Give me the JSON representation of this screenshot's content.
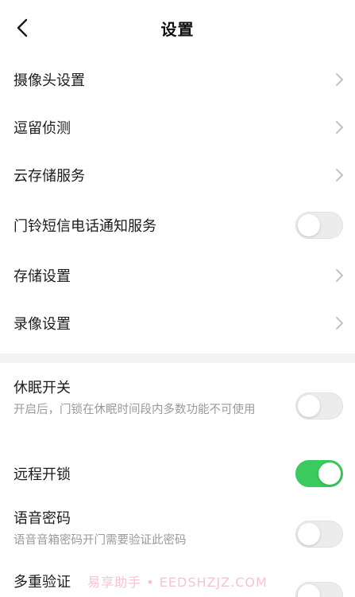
{
  "header": {
    "title": "设置"
  },
  "section1": {
    "items": [
      {
        "label": "摄像头设置"
      },
      {
        "label": "逗留侦测"
      },
      {
        "label": "云存储服务"
      },
      {
        "label": "门铃短信电话通知服务"
      },
      {
        "label": "存储设置"
      },
      {
        "label": "录像设置"
      }
    ]
  },
  "section2": {
    "sleep": {
      "label": "休眠开关",
      "desc": "开启后，门锁在休眠时间段内多数功能不可使用"
    },
    "remote_unlock": {
      "label": "远程开锁"
    },
    "voice_password": {
      "label": "语音密码",
      "desc": "语音音箱密码开门需要验证此密码"
    },
    "multi_verify": {
      "label": "多重验证"
    }
  },
  "toggles": {
    "doorbell_notify": false,
    "sleep": false,
    "remote_unlock": true,
    "voice_password": false
  },
  "colors": {
    "accent_green": "#3bca5d",
    "toggle_off": "#ececec"
  },
  "watermark": "易享助手 • EEDSHZJZ.COM"
}
